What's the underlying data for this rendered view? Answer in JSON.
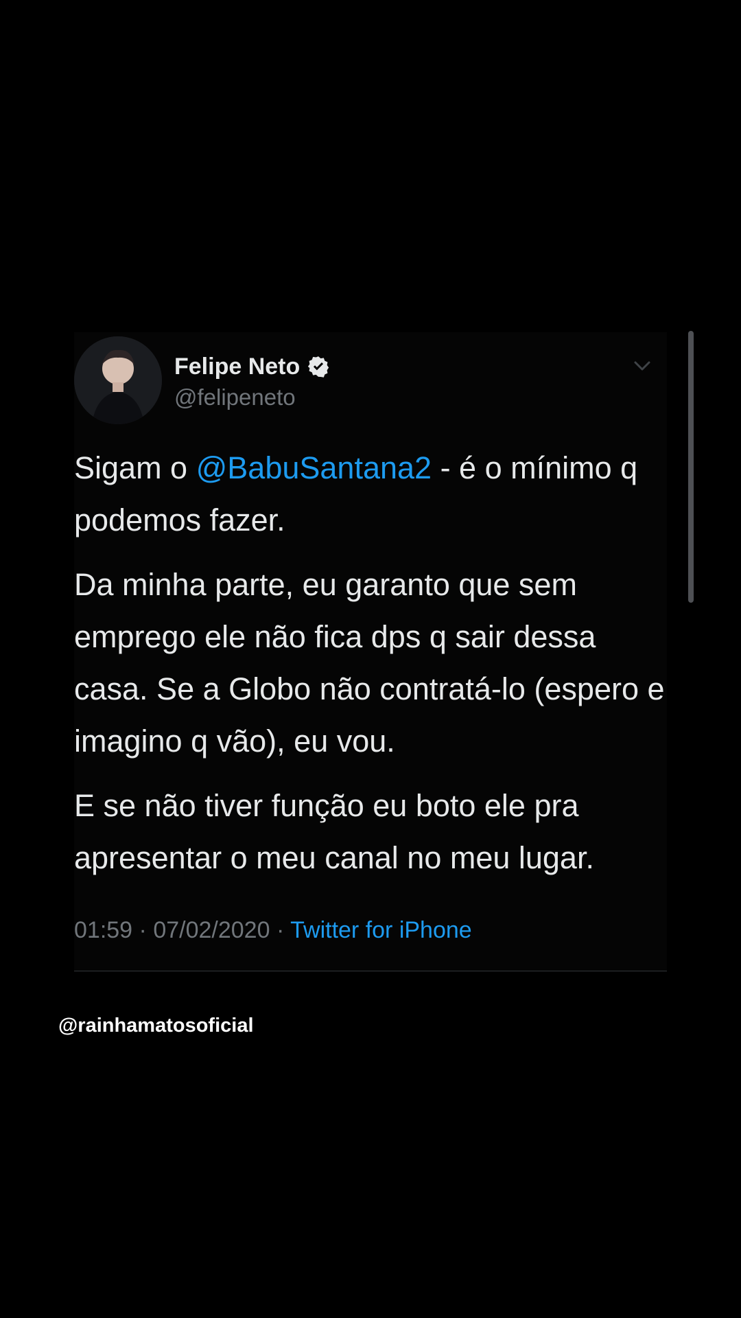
{
  "tweet": {
    "author_name": "Felipe Neto",
    "author_handle": "@felipeneto",
    "verified": true,
    "paragraphs": [
      {
        "before": "Sigam o ",
        "mention": "@BabuSantana2",
        "after": " - é o mínimo q podemos fazer."
      },
      {
        "text": "Da minha parte, eu garanto que sem emprego ele não fica dps q sair dessa casa. Se a Globo não contratá-lo (espero e imagino q vão), eu vou."
      },
      {
        "text": "E se não tiver função eu boto ele pra apresentar o meu canal no meu lugar."
      }
    ],
    "time": "01:59",
    "separator": "·",
    "date": "07/02/2020",
    "source": "Twitter for iPhone"
  },
  "watermark": "@rainhamatosoficial",
  "colors": {
    "background": "#000000",
    "text": "#e7e9ea",
    "muted": "#71767b",
    "link": "#1d9bf0"
  },
  "icons": {
    "verified": "verified-badge-icon",
    "menu": "chevron-down-icon"
  }
}
